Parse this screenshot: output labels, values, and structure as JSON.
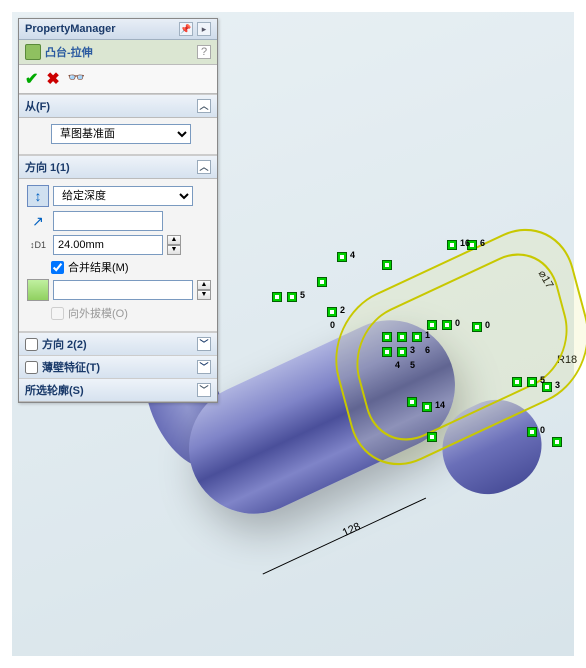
{
  "pm": {
    "title": "PropertyManager",
    "feature_name": "凸台-拉伸",
    "from_label": "从(F)",
    "from_value": "草图基准面",
    "dir1_label": "方向 1(1)",
    "end_condition": "给定深度",
    "depth_value": "24.00mm",
    "merge_label": "合并结果(M)",
    "draft_outward": "向外拔模(O)",
    "dir2_label": "方向 2(2)",
    "thin_label": "薄壁特征(T)",
    "contours_label": "所选轮廓(S)"
  },
  "dims": {
    "length": "128",
    "dia": "⌀17",
    "radius": "R18"
  },
  "rel_labels": [
    "0",
    "0",
    "1",
    "2",
    "3",
    "4",
    "5",
    "5",
    "6",
    "6",
    "14",
    "16"
  ]
}
